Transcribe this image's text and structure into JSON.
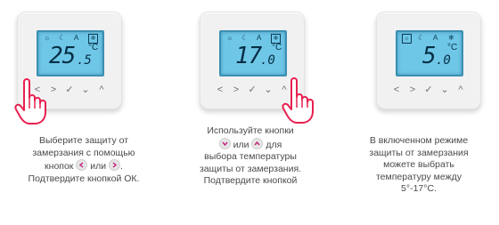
{
  "panels": [
    {
      "lcd": {
        "temp_main": "25",
        "temp_decimal": ".5",
        "unit": "°C",
        "icon_sun": "☼",
        "icon_moon": "☾",
        "icon_auto": "A",
        "icon_snow": "❄"
      },
      "buttons": [
        "<",
        ">",
        "✓",
        "⌄",
        "^"
      ],
      "caption": {
        "line1": "Выберите защиту от",
        "line2": "замерзания с помощью",
        "line3_a": "кнопок",
        "line3_b": "или",
        "line3_c": ".",
        "line4": "Подтвердите кнопкой ОК."
      }
    },
    {
      "lcd": {
        "temp_main": "17",
        "temp_decimal": ".0",
        "unit": "°C",
        "icon_sun": "☼",
        "icon_moon": "☾",
        "icon_auto": "A",
        "icon_snow": "❄"
      },
      "buttons": [
        "<",
        ">",
        "✓",
        "⌄",
        "^"
      ],
      "caption": {
        "line1": "Используйте кнопки",
        "line2_a": "или",
        "line2_b": "для",
        "line3": "выбора температуры",
        "line4": "защиты от замерзания.",
        "line5": "Подтвердите кнопкой"
      }
    },
    {
      "lcd": {
        "temp_main": "5",
        "temp_decimal": ".0",
        "unit": "°C",
        "icon_sun": "☼",
        "icon_moon": "☾",
        "icon_auto": "A",
        "icon_snow": "❄"
      },
      "buttons": [
        "<",
        ">",
        "✓",
        "⌄",
        "^"
      ],
      "caption": {
        "line1": "В включенном режиме",
        "line2": "защиты от замерзания",
        "line3": "можете выбрать",
        "line4": "температуру между",
        "line5": "5°-17°C."
      }
    }
  ]
}
